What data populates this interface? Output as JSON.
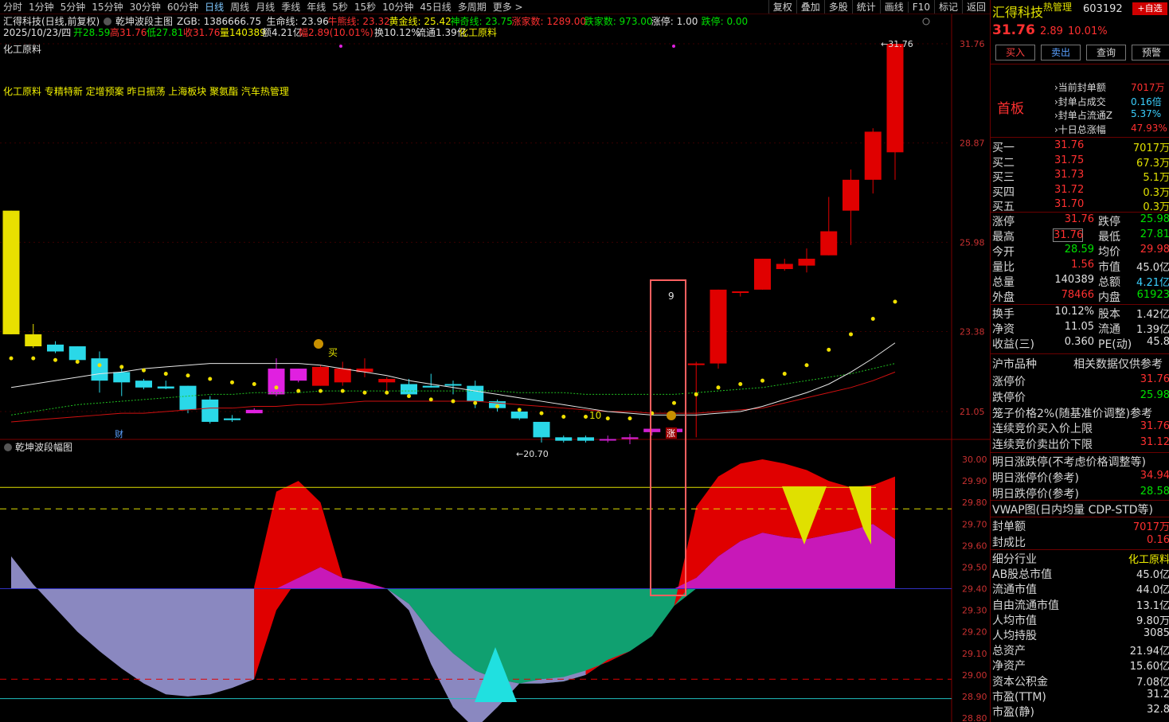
{
  "period_tabs": [
    "分时",
    "1分钟",
    "5分钟",
    "15分钟",
    "30分钟",
    "60分钟",
    "日线",
    "周线",
    "月线",
    "季线",
    "年线",
    "5秒",
    "15秒",
    "10分钟",
    "45日线",
    "多周期",
    "更多 >"
  ],
  "active_period": "日线",
  "right_tools": [
    "复权",
    "叠加",
    "多股",
    "统计",
    "画线",
    "F10",
    "标记",
    "返回"
  ],
  "main": {
    "title": "汇得科技(日线,前复权)",
    "indicator_name": "乾坤波段主图",
    "fields": [
      {
        "text": "ZGB: 1386666.75",
        "color": "#e0e0e0"
      },
      {
        "text": "生命线: 23.96",
        "color": "#e0e0e0"
      },
      {
        "text": "牛熊线: 23.32",
        "color": "#ff3030"
      },
      {
        "text": "黄金线: 25.42",
        "color": "#f0f000"
      },
      {
        "text": "神奇线: 23.75",
        "color": "#00e000"
      },
      {
        "text": "涨家数: 1289.00",
        "color": "#ff3030"
      },
      {
        "text": "跌家数: 973.00",
        "color": "#00e000"
      },
      {
        "text": "涨停: 1.00",
        "color": "#e0e0e0"
      },
      {
        "text": "跌停: 0.00",
        "color": "#00e000"
      }
    ],
    "info2": [
      {
        "text": "2025/10/23/四",
        "color": "#e0e0e0"
      },
      {
        "text": "开28.59",
        "color": "#00e000"
      },
      {
        "text": "高31.76",
        "color": "#ff3030"
      },
      {
        "text": "低27.81",
        "color": "#00e000"
      },
      {
        "text": "收31.76",
        "color": "#ff3030"
      },
      {
        "text": "量140389",
        "color": "#f0f000"
      },
      {
        "text": "额4.21亿",
        "color": "#e0e0e0"
      },
      {
        "text": "幅2.89(10.01%)",
        "color": "#ff3030"
      },
      {
        "text": "换10.12%",
        "color": "#e0e0e0"
      },
      {
        "text": "流通1.39亿",
        "color": "#e0e0e0"
      },
      {
        "text": "化工原料",
        "color": "#f0f000"
      }
    ],
    "industry_label": "化工原料",
    "concepts": "化工原料 专精特新 定增预案 昨日振荡 上海板块 聚氨酯 汽车热管理",
    "price_ticks": [
      "31.76",
      "28.87",
      "25.98",
      "23.38",
      "21.05"
    ],
    "price_range": [
      20.0,
      32.8
    ],
    "last_price_label": "31.76",
    "low_label": "20.70",
    "annotations": {
      "buy": "买",
      "nine": "9",
      "ten": "10",
      "zhang": "涨",
      "cai": "财"
    },
    "candles": [
      {
        "o": 23.3,
        "h": 26.9,
        "l": 23.3,
        "c": 26.9
      },
      {
        "o": 23.3,
        "h": 23.6,
        "l": 22.9,
        "c": 22.95
      },
      {
        "o": 23.0,
        "h": 23.1,
        "l": 22.75,
        "c": 22.8
      },
      {
        "o": 22.95,
        "h": 22.95,
        "l": 22.5,
        "c": 22.55
      },
      {
        "o": 22.6,
        "h": 22.8,
        "l": 21.6,
        "c": 21.95
      },
      {
        "o": 22.2,
        "h": 22.4,
        "l": 21.5,
        "c": 21.9
      },
      {
        "o": 21.95,
        "h": 22.0,
        "l": 21.7,
        "c": 21.75
      },
      {
        "o": 21.78,
        "h": 21.95,
        "l": 21.7,
        "c": 21.72
      },
      {
        "o": 21.8,
        "h": 21.8,
        "l": 21.0,
        "c": 21.1
      },
      {
        "o": 21.4,
        "h": 21.5,
        "l": 20.7,
        "c": 20.75
      },
      {
        "o": 20.85,
        "h": 20.95,
        "l": 20.75,
        "c": 20.8
      },
      {
        "o": 21.1,
        "h": 21.15,
        "l": 21.0,
        "c": 21.0
      },
      {
        "o": 22.3,
        "h": 22.6,
        "l": 21.5,
        "c": 21.55
      },
      {
        "o": 22.3,
        "h": 22.3,
        "l": 21.9,
        "c": 21.95
      },
      {
        "o": 21.8,
        "h": 22.4,
        "l": 21.8,
        "c": 22.35
      },
      {
        "o": 21.9,
        "h": 22.5,
        "l": 21.8,
        "c": 22.3
      },
      {
        "o": 22.3,
        "h": 22.6,
        "l": 22.05,
        "c": 22.2
      },
      {
        "o": 22.0,
        "h": 22.05,
        "l": 21.65,
        "c": 21.9
      },
      {
        "o": 21.55,
        "h": 22.0,
        "l": 21.5,
        "c": 21.85
      },
      {
        "o": 21.8,
        "h": 22.15,
        "l": 21.75,
        "c": 21.75
      },
      {
        "o": 21.85,
        "h": 21.95,
        "l": 21.55,
        "c": 21.85
      },
      {
        "o": 21.8,
        "h": 21.95,
        "l": 21.15,
        "c": 21.35
      },
      {
        "o": 21.35,
        "h": 21.4,
        "l": 21.05,
        "c": 21.15
      },
      {
        "o": 21.05,
        "h": 21.1,
        "l": 20.8,
        "c": 20.85
      },
      {
        "o": 20.75,
        "h": 20.75,
        "l": 20.15,
        "c": 20.3
      },
      {
        "o": 20.3,
        "h": 20.35,
        "l": 20.15,
        "c": 20.2
      },
      {
        "o": 20.3,
        "h": 20.35,
        "l": 20.15,
        "c": 20.2
      },
      {
        "o": 20.25,
        "h": 20.35,
        "l": 20.15,
        "c": 20.25
      },
      {
        "o": 20.25,
        "h": 20.4,
        "l": 20.1,
        "c": 20.3
      },
      {
        "o": 20.45,
        "h": 20.55,
        "l": 20.35,
        "c": 20.55
      },
      {
        "o": 20.45,
        "h": 20.55,
        "l": 20.45,
        "c": 20.55
      },
      {
        "o": 22.45,
        "h": 22.5,
        "l": 20.3,
        "c": 22.45
      },
      {
        "o": 22.45,
        "h": 24.6,
        "l": 22.3,
        "c": 24.6
      },
      {
        "o": 24.55,
        "h": 24.55,
        "l": 24.4,
        "c": 24.55
      },
      {
        "o": 24.6,
        "h": 25.5,
        "l": 24.6,
        "c": 25.5
      },
      {
        "o": 25.2,
        "h": 25.5,
        "l": 25.15,
        "c": 25.35
      },
      {
        "o": 25.3,
        "h": 25.8,
        "l": 25.1,
        "c": 25.5
      },
      {
        "o": 25.6,
        "h": 27.3,
        "l": 25.6,
        "c": 26.3
      },
      {
        "o": 26.9,
        "h": 28.1,
        "l": 25.9,
        "c": 27.8
      },
      {
        "o": 27.8,
        "h": 29.3,
        "l": 27.4,
        "c": 29.2
      },
      {
        "o": 28.6,
        "h": 31.76,
        "l": 27.8,
        "c": 31.76
      }
    ],
    "candle_kind": [
      "y",
      "y",
      "c",
      "c",
      "c",
      "c",
      "c",
      "c",
      "c",
      "c",
      "c",
      "m",
      "m",
      "m",
      "r",
      "r",
      "r",
      "r",
      "c",
      "c",
      "c",
      "c",
      "c",
      "c",
      "c",
      "c",
      "c",
      "p",
      "p",
      "p",
      "p",
      "r",
      "r",
      "r",
      "r",
      "r",
      "r",
      "r",
      "r",
      "r",
      "r"
    ],
    "yellow_dots": [
      22.6,
      22.6,
      22.55,
      22.5,
      22.4,
      22.35,
      22.25,
      22.15,
      22.1,
      22.0,
      21.9,
      21.85,
      21.75,
      21.65,
      21.65,
      21.65,
      21.6,
      21.6,
      21.5,
      21.4,
      21.35,
      21.3,
      21.2,
      21.1,
      21.0,
      20.9,
      20.9,
      20.85,
      20.85,
      21.0,
      21.3,
      21.55,
      21.75,
      21.85,
      21.95,
      22.15,
      22.4,
      22.85,
      23.3,
      23.75,
      24.25
    ],
    "white_line": [
      21.75,
      21.85,
      21.95,
      22.05,
      22.15,
      22.2,
      22.3,
      22.35,
      22.4,
      22.45,
      22.45,
      22.45,
      22.45,
      22.45,
      22.4,
      22.3,
      22.2,
      22.1,
      21.95,
      21.85,
      21.75,
      21.65,
      21.55,
      21.45,
      21.35,
      21.25,
      21.15,
      21.05,
      21.0,
      20.95,
      20.95,
      20.95,
      21.0,
      21.05,
      21.2,
      21.4,
      21.6,
      21.85,
      22.2,
      22.6,
      23.05
    ],
    "green_line": [
      20.95,
      21.05,
      21.15,
      21.25,
      21.3,
      21.35,
      21.4,
      21.45,
      21.5,
      21.55,
      21.55,
      21.6,
      21.6,
      21.6,
      21.65,
      21.65,
      21.65,
      21.65,
      21.65,
      21.65,
      21.65,
      21.65,
      21.65,
      21.6,
      21.6,
      21.6,
      21.55,
      21.55,
      21.55,
      21.55,
      21.55,
      21.6,
      21.65,
      21.7,
      21.75,
      21.85,
      21.95,
      22.05,
      22.15,
      22.3,
      22.45
    ],
    "red_line": [
      20.75,
      20.8,
      20.85,
      20.9,
      20.95,
      21.0,
      21.0,
      21.05,
      21.1,
      21.15,
      21.15,
      21.2,
      21.2,
      21.25,
      21.25,
      21.3,
      21.35,
      21.35,
      21.35,
      21.35,
      21.35,
      21.35,
      21.3,
      21.25,
      21.2,
      21.15,
      21.1,
      21.05,
      21.05,
      21.0,
      21.0,
      21.0,
      21.05,
      21.1,
      21.15,
      21.3,
      21.45,
      21.6,
      21.75,
      21.95,
      22.2
    ]
  },
  "sub": {
    "title": "乾坤波段幅图",
    "ticks": [
      "30.00",
      "29.90",
      "29.80",
      "29.70",
      "29.60",
      "29.50",
      "29.40",
      "29.30",
      "29.20",
      "29.10",
      "29.00",
      "28.90",
      "28.80"
    ],
    "range": [
      28.8,
      30.0
    ],
    "baseline": 29.4,
    "upper": [
      29.41,
      29.41,
      29.41,
      29.41,
      29.41,
      29.41,
      29.41,
      29.41,
      29.41,
      29.41,
      29.41,
      29.41,
      29.85,
      29.9,
      29.8,
      29.45,
      29.42,
      29.4,
      29.33,
      29.2,
      29.1,
      29.02,
      28.98,
      28.96,
      28.96,
      28.97,
      29.0,
      29.07,
      29.11,
      29.18,
      29.32,
      29.78,
      29.92,
      29.98,
      30.0,
      29.98,
      29.95,
      29.9,
      29.87,
      29.88,
      29.92
    ],
    "lower": [
      29.55,
      29.42,
      29.31,
      29.2,
      29.11,
      29.03,
      28.96,
      28.91,
      28.9,
      28.91,
      28.94,
      28.98,
      29.3,
      29.45,
      29.5,
      29.45,
      29.43,
      29.4,
      29.3,
      29.05,
      28.85,
      28.75,
      28.85,
      28.96,
      28.98,
      28.99,
      29.02,
      29.06,
      29.11,
      29.18,
      29.32,
      29.45,
      29.55,
      29.62,
      29.66,
      29.64,
      29.63,
      29.65,
      29.67,
      29.7,
      29.63
    ]
  },
  "side": {
    "stock_name": "汇得科技",
    "hot_tag": "热管理",
    "code": "603192",
    "self_select": "+自选",
    "price": "31.76",
    "change": "2.89",
    "change_pct": "10.01%",
    "buttons": [
      "买入",
      "卖出",
      "查询",
      "预警"
    ],
    "board_title": "首板",
    "seal_info": [
      {
        "label": "当前封单额",
        "value": "7017万",
        "color": "#ff3030"
      },
      {
        "label": "封单占成交",
        "value": "0.16倍",
        "color": "#3ad0ff"
      },
      {
        "label": "封单占流通Z",
        "value": "5.37%",
        "color": "#3ad0ff"
      },
      {
        "label": "十日总涨幅",
        "value": "47.93%",
        "color": "#ff3030"
      }
    ],
    "bids": [
      {
        "label": "买一",
        "price": "31.76",
        "vol": "7017万"
      },
      {
        "label": "买二",
        "price": "31.75",
        "vol": "67.3万"
      },
      {
        "label": "买三",
        "price": "31.73",
        "vol": "5.1万"
      },
      {
        "label": "买四",
        "price": "31.72",
        "vol": "0.3万"
      },
      {
        "label": "买五",
        "price": "31.70",
        "vol": "0.3万"
      }
    ],
    "quote": [
      {
        "l1": "涨停",
        "v1": "31.76",
        "c1": "#ff3030",
        "l2": "跌停",
        "v2": "25.98",
        "c2": "#00e000"
      },
      {
        "l1": "最高",
        "v1": "31.76",
        "c1": "#ff3030",
        "l2": "最低",
        "v2": "27.81",
        "c2": "#00e000"
      },
      {
        "l1": "今开",
        "v1": "28.59",
        "c1": "#00e000",
        "l2": "均价",
        "v2": "29.98",
        "c2": "#ff3030"
      },
      {
        "l1": "量比",
        "v1": "1.56",
        "c1": "#ff3030",
        "l2": "市值",
        "v2": "45.0亿",
        "c2": "#e0e0e0"
      },
      {
        "l1": "总量",
        "v1": "140389",
        "c1": "#e0e0e0",
        "l2": "总额",
        "v2": "4.21亿",
        "c2": "#3ad0ff"
      },
      {
        "l1": "外盘",
        "v1": "78466",
        "c1": "#ff3030",
        "l2": "内盘",
        "v2": "61923",
        "c2": "#00e000"
      }
    ],
    "quote2": [
      {
        "l1": "换手",
        "v1": "10.12%",
        "l2": "股本",
        "v2": "1.42亿"
      },
      {
        "l1": "净资",
        "v1": "11.05",
        "l2": "流通",
        "v2": "1.39亿"
      },
      {
        "l1": "收益(三)",
        "v1": "0.360",
        "l2": "PE(动)",
        "v2": "45.8"
      }
    ],
    "sh_title": "沪市品种",
    "sh_ref": "相关数据仅供参考",
    "limits": [
      {
        "label": "涨停价",
        "value": "31.76",
        "color": "#ff3030"
      },
      {
        "label": "跌停价",
        "value": "25.98",
        "color": "#00e000"
      }
    ],
    "cage": "笼子价格2%(随基准价调整)参考",
    "auction": [
      {
        "label": "连续竞价买入价上限",
        "value": "31.76",
        "color": "#ff3030"
      },
      {
        "label": "连续竞价卖出价下限",
        "value": "31.12",
        "color": "#ff3030"
      }
    ],
    "tomorrow_title": "明日涨跌停(不考虑价格调整等)",
    "tomorrow": [
      {
        "label": "明日涨停价(参考)",
        "value": "34.94",
        "color": "#ff3030"
      },
      {
        "label": "明日跌停价(参考)",
        "value": "28.58",
        "color": "#00e000"
      }
    ],
    "vwap": "VWAP图(日内均量 CDP-STD等)",
    "seal_rows": [
      {
        "label": "封单额",
        "value": "7017万",
        "color": "#ff3030"
      },
      {
        "label": "封成比",
        "value": "0.16",
        "color": "#ff3030"
      }
    ],
    "fin": [
      {
        "label": "细分行业",
        "value": "化工原料",
        "color": "#f0f000"
      },
      {
        "label": "AB股总市值",
        "value": "45.0亿",
        "color": "#e0e0e0"
      },
      {
        "label": "流通市值",
        "value": "44.0亿",
        "color": "#e0e0e0"
      },
      {
        "label": "自由流通市值",
        "value": "13.1亿",
        "color": "#e0e0e0"
      },
      {
        "label": "人均市值",
        "value": "9.80万",
        "color": "#e0e0e0"
      },
      {
        "label": "人均持股",
        "value": "3085",
        "color": "#e0e0e0"
      },
      {
        "label": "总资产",
        "value": "21.94亿",
        "color": "#e0e0e0"
      },
      {
        "label": "净资产",
        "value": "15.60亿",
        "color": "#e0e0e0"
      },
      {
        "label": "资本公积金",
        "value": "7.08亿",
        "color": "#e0e0e0"
      },
      {
        "label": "市盈(TTM)",
        "value": "31.2",
        "color": "#e0e0e0"
      },
      {
        "label": "市盈(静)",
        "value": "32.8",
        "color": "#e0e0e0"
      }
    ]
  }
}
